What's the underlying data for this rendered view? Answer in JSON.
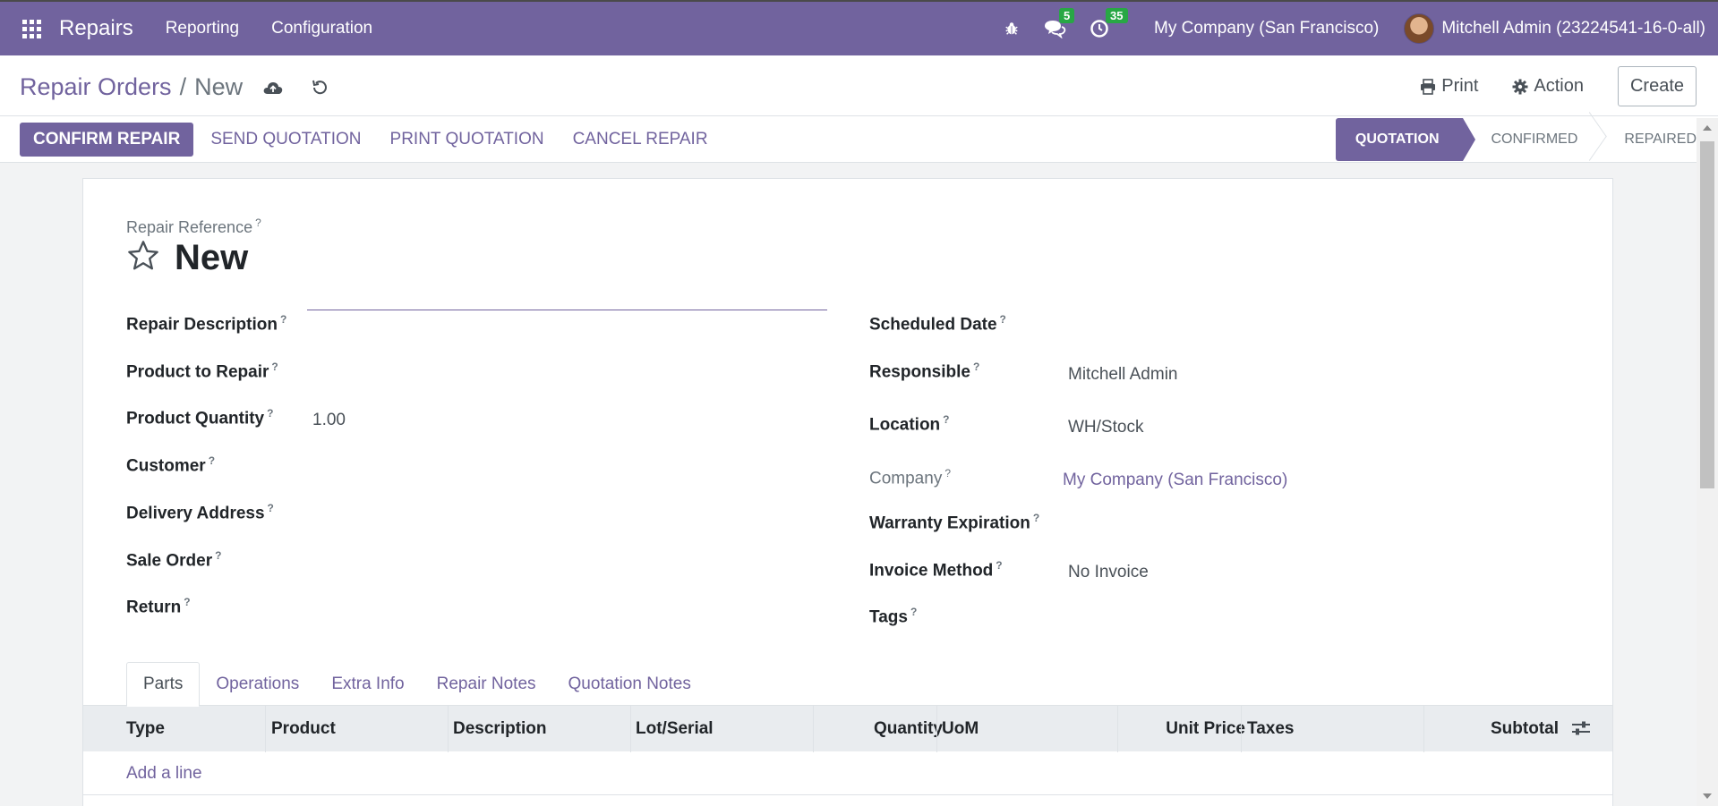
{
  "navbar": {
    "brand": "Repairs",
    "menus": [
      "Reporting",
      "Configuration"
    ],
    "messages_count": "5",
    "activities_count": "35",
    "company": "My Company (San Francisco)",
    "user": "Mitchell Admin (23224541-16-0-all)"
  },
  "control_panel": {
    "breadcrumb_parent": "Repair Orders",
    "breadcrumb_separator": "/",
    "breadcrumb_current": "New",
    "print_label": "Print",
    "action_label": "Action",
    "create_label": "Create"
  },
  "statusbar": {
    "confirm_label": "CONFIRM REPAIR",
    "send_label": "SEND QUOTATION",
    "print_label": "PRINT QUOTATION",
    "cancel_label": "CANCEL REPAIR",
    "stages": [
      "QUOTATION",
      "CONFIRMED",
      "REPAIRED"
    ],
    "active_stage": "QUOTATION"
  },
  "form": {
    "ref_label": "Repair Reference",
    "title": "New",
    "help_mark": "?",
    "left": {
      "description_label": "Repair Description",
      "product_label": "Product to Repair",
      "quantity_label": "Product Quantity",
      "quantity_value": "1.00",
      "customer_label": "Customer",
      "delivery_label": "Delivery Address",
      "sale_order_label": "Sale Order",
      "return_label": "Return"
    },
    "right": {
      "scheduled_label": "Scheduled Date",
      "responsible_label": "Responsible",
      "responsible_value": "Mitchell Admin",
      "location_label": "Location",
      "location_value": "WH/Stock",
      "company_label": "Company",
      "company_value": "My Company (San Francisco)",
      "warranty_label": "Warranty Expiration",
      "invoice_label": "Invoice Method",
      "invoice_value": "No Invoice",
      "tags_label": "Tags"
    }
  },
  "tabs": [
    "Parts",
    "Operations",
    "Extra Info",
    "Repair Notes",
    "Quotation Notes"
  ],
  "table": {
    "columns": [
      "Type",
      "Product",
      "Description",
      "Lot/Serial",
      "Quantity",
      "UoM",
      "Unit Price",
      "Taxes",
      "Subtotal"
    ],
    "add_line": "Add a line"
  },
  "colors": {
    "brand": "#71639e",
    "badge": "#28a745"
  }
}
